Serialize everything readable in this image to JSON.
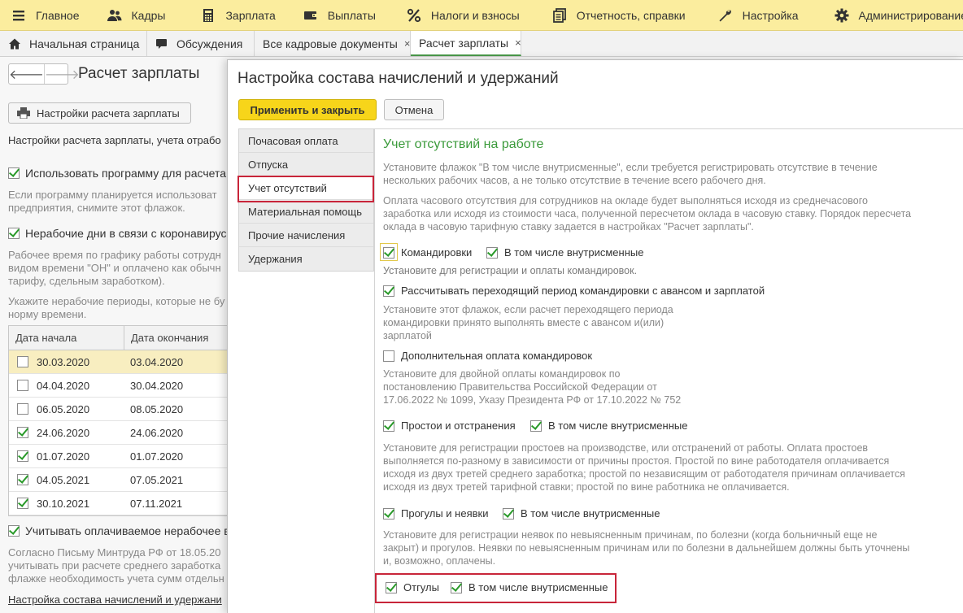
{
  "top_menu": [
    {
      "label": "Главное",
      "icon": "hamburger-icon"
    },
    {
      "label": "Кадры",
      "icon": "people-icon"
    },
    {
      "label": "Зарплата",
      "icon": "calculator-icon"
    },
    {
      "label": "Выплаты",
      "icon": "wallet-icon"
    },
    {
      "label": "Налоги и взносы",
      "icon": "percent-icon"
    },
    {
      "label": "Отчетность, справки",
      "icon": "documents-icon"
    },
    {
      "label": "Настройка",
      "icon": "wrench-icon"
    },
    {
      "label": "Администрирование",
      "icon": "gear-icon"
    }
  ],
  "tabs": [
    {
      "label": "Начальная страница",
      "icon": "home-icon"
    },
    {
      "label": "Обсуждения",
      "icon": "chat-icon"
    },
    {
      "label": "Все кадровые документы",
      "close": "×"
    },
    {
      "label": "Расчет зарплаты",
      "close": "×"
    }
  ],
  "background": {
    "nav_back": "🡐",
    "nav_forward": "🡒",
    "title": "Расчет зарплаты",
    "settings_button": "Настройки расчета зарплаты",
    "intro": "Настройки расчета зарплаты, учета отрабо",
    "use_program_label": "Использовать программу для расчета за",
    "use_program_hint1": "Если программу планируется использоват",
    "use_program_hint2": "предприятия, снимите этот флажок.",
    "nonworking_label": "Нерабочие дни в связи с коронавирусом",
    "nonworking_hint1": "Рабочее время по графику работы сотрудн",
    "nonworking_hint2": "видом времени \"ОН\" и оплачено как обычн",
    "nonworking_hint3": "тарифу, сдельным заработком).",
    "periods_hint1": "Укажите нерабочие периоды, которые не бу",
    "periods_hint2": "норму времени.",
    "table": {
      "col_start": "Дата начала",
      "col_end": "Дата окончания",
      "rows": [
        {
          "start": "30.03.2020",
          "end": "03.04.2020",
          "checked": false
        },
        {
          "start": "04.04.2020",
          "end": "30.04.2020",
          "checked": false
        },
        {
          "start": "06.05.2020",
          "end": "08.05.2020",
          "checked": false
        },
        {
          "start": "24.06.2020",
          "end": "24.06.2020",
          "checked": true
        },
        {
          "start": "01.07.2020",
          "end": "01.07.2020",
          "checked": true
        },
        {
          "start": "04.05.2021",
          "end": "07.05.2021",
          "checked": true
        },
        {
          "start": "30.10.2021",
          "end": "07.11.2021",
          "checked": true
        }
      ]
    },
    "paid_nonworking_label": "Учитывать оплачиваемое нерабочее вр",
    "letter_hint1": "Согласно Письму Минтруда РФ от 18.05.20",
    "letter_hint2": "учитывать при расчете среднего заработка",
    "letter_hint3": "флажке необходимость учета сумм отдельн",
    "link": "Настройка состава начислений и удержани"
  },
  "dialog": {
    "title": "Настройка состава начислений и удержаний",
    "apply_button": "Применить и закрыть",
    "cancel_button": "Отмена",
    "nav": [
      "Почасовая оплата",
      "Отпуска",
      "Учет отсутствий",
      "Материальная помощь",
      "Прочие начисления",
      "Удержания"
    ],
    "section_title": "Учет отсутствий на работе",
    "intro1": "Установите флажок \"В том числе внутрисменные\", если требуется регистрировать отсутствие в течение",
    "intro2": "нескольких рабочих часов, а не только отсутствие в течение всего рабочего дня.",
    "intro3": "Оплата часового отсутствия для сотрудников на окладе будет выполняться исходя из среднечасового",
    "intro4": "заработка или исходя из стоимости часа, полученной пересчетом оклада в часовую ставку. Порядок пересчета",
    "intro5": "оклада в часовую тарифную ставку задается в настройках \"Расчет зарплаты\".",
    "trips_label": "Командировки",
    "trips_intrashift": "В том числе внутрисменные",
    "trips_hint": "Установите для регистрации и оплаты командировок.",
    "transition_label": "Рассчитывать переходящий период командировки с авансом и зарплатой",
    "transition_hint1": "Установите этот флажок, если расчет переходящего периода",
    "transition_hint2": "командировки принято выполнять вместе с авансом и(или)",
    "transition_hint3": "зарплатой",
    "extra_trips_label": "Дополнительная оплата командировок",
    "extra_hint1": "Установите для двойной оплаты командировок по",
    "extra_hint2": "постановлению Правительства Российской Федерации от",
    "extra_hint3": "17.06.2022 № 1099, Указу Президента РФ от 17.10.2022 № 752",
    "downtime_label": "Простои и отстранения",
    "downtime_intrashift": "В том числе внутрисменные",
    "downtime_hint1": "Установите для регистрации простоев на производстве, или отстранений от работы. Оплата простоев",
    "downtime_hint2": "выполняется по-разному в зависимости от причины простоя. Простой по вине работодателя оплачивается",
    "downtime_hint3": "исходя из двух третей среднего заработка; простой по независящим от работодателя причинам оплачивается",
    "downtime_hint4": "исходя из двух третей тарифной ставки; простой по вине работника не оплачивается.",
    "absence_label": "Прогулы и неявки",
    "absence_intrashift": "В том числе внутрисменные",
    "absence_hint1": "Установите для регистрации неявок по невыясненным причинам, по болезни (когда больничный еще не",
    "absence_hint2": "закрыт) и прогулов. Неявки по невыясненным причинам или по болезни в дальнейшем должны быть уточнены",
    "absence_hint3": "и, возможно, оплачены.",
    "timeoff_label": "Отгулы",
    "timeoff_intrashift": "В том числе внутрисменные"
  },
  "colors": {
    "menu_bg": "#fbed9e",
    "apply_button": "#f7d51a",
    "section_title": "#3a9a3a",
    "highlight_box": "#c8253a",
    "check": "#2a9a2a"
  }
}
